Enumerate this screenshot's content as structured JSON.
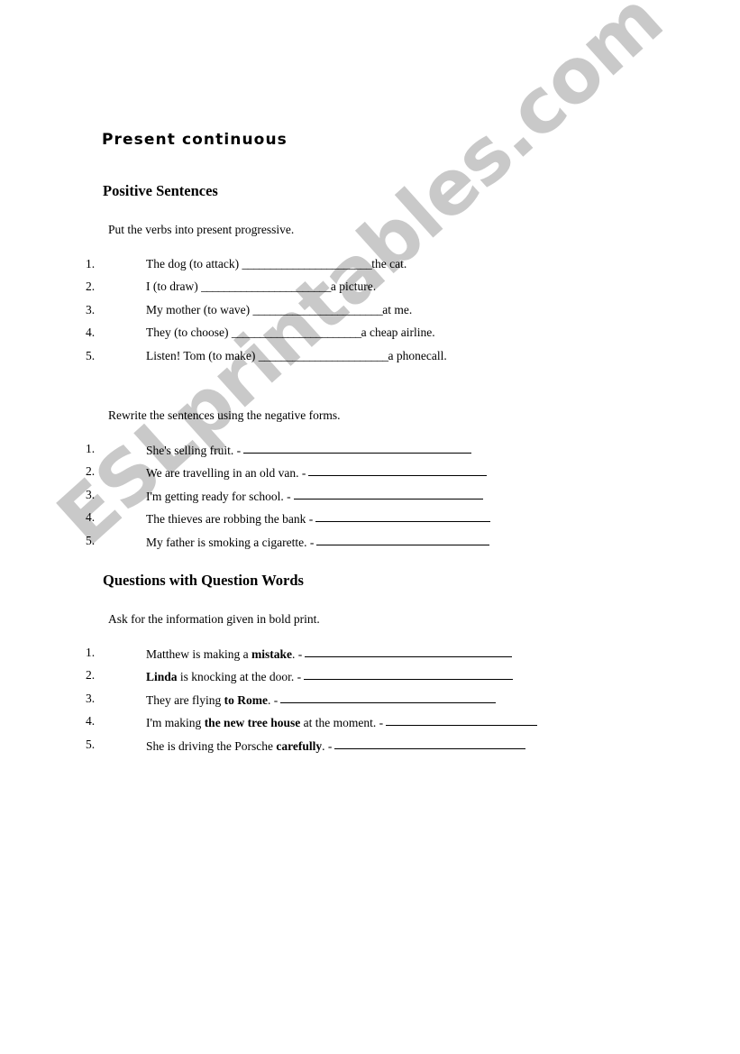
{
  "document": {
    "title": "Present continuous",
    "watermark": "ESLprintables.com",
    "watermark_color": "#c9c9c9"
  },
  "sections": [
    {
      "heading": "Positive Sentences",
      "instruction": "Put the verbs into present progressive.",
      "items": [
        {
          "number": "1.",
          "before": "The dog (to attack) ",
          "blank": "_______________________",
          "after": "the cat."
        },
        {
          "number": "2.",
          "before": "I (to draw) ",
          "blank": "_______________________",
          "after": "a picture."
        },
        {
          "number": "3.",
          "before": "My mother (to wave) ",
          "blank": "_______________________",
          "after": "at me."
        },
        {
          "number": "4.",
          "before": "They (to choose) ",
          "blank": "_______________________",
          "after": "a cheap airline."
        },
        {
          "number": "5.",
          "before": "Listen!  Tom (to make) ",
          "blank": "_______________________",
          "after": "a phonecall."
        }
      ]
    },
    {
      "heading": "",
      "instruction": "Rewrite the sentences using the negative forms.",
      "items": [
        {
          "number": "1.",
          "sentence": "She's selling fruit.  -",
          "rule_width": 253
        },
        {
          "number": "2.",
          "sentence": "We are travelling in an old van.  -",
          "rule_width": 198
        },
        {
          "number": "3.",
          "sentence": "I'm getting ready for school.  -",
          "rule_width": 210
        },
        {
          "number": "4.",
          "sentence": "The thieves are robbing the bank  -",
          "rule_width": 194
        },
        {
          "number": "5.",
          "sentence": "My father is smoking a cigarette.  -",
          "rule_width": 192
        }
      ]
    },
    {
      "heading": "Questions with Question Words",
      "instruction": "Ask for the information given in bold print.",
      "items": [
        {
          "number": "1.",
          "pre": "Matthew is making a ",
          "bold": "mistake",
          "post": ".  -",
          "rule_width": 230
        },
        {
          "number": "2.",
          "pre": "",
          "bold": "Linda",
          "post": " is knocking at the door.  -",
          "rule_width": 232
        },
        {
          "number": "3.",
          "pre": "They are flying ",
          "bold": "to Rome",
          "post": ".  -",
          "rule_width": 239
        },
        {
          "number": "4.",
          "pre": "I'm making ",
          "bold": "the new tree house",
          "post": " at the moment.  -",
          "rule_width": 168
        },
        {
          "number": "5.",
          "pre": "She is driving the Porsche ",
          "bold": "carefully",
          "post": ".  -",
          "rule_width": 212
        }
      ]
    }
  ]
}
